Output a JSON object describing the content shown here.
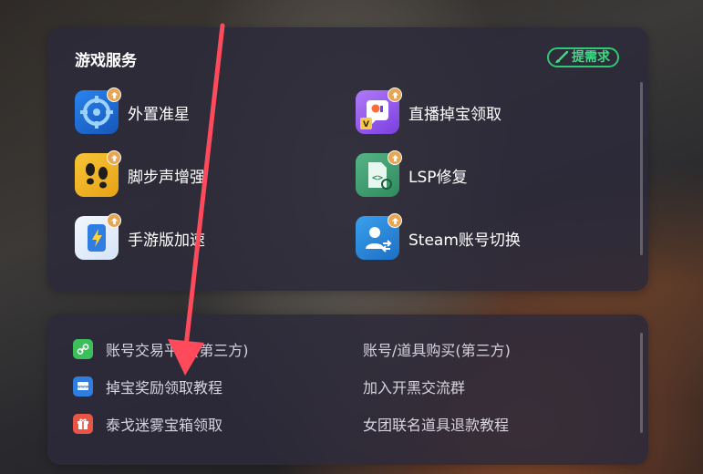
{
  "services_panel": {
    "title": "游戏服务",
    "request_button": "提需求",
    "items": [
      {
        "label": "外置准星",
        "icon": "crosshair-icon",
        "color": "#1f6fd6"
      },
      {
        "label": "直播掉宝领取",
        "icon": "twitch-drop-icon",
        "color": "#9b5cf0"
      },
      {
        "label": "脚步声增强",
        "icon": "footsteps-icon",
        "color": "#f2b21c"
      },
      {
        "label": "LSP修复",
        "icon": "lsp-fix-icon",
        "color": "#3f9e6e"
      },
      {
        "label": "手游版加速",
        "icon": "mobile-boost-icon",
        "color": "#e6eef9"
      },
      {
        "label": "Steam账号切换",
        "icon": "account-switch-icon",
        "color": "#2b8ee0"
      }
    ]
  },
  "links_panel": {
    "items": [
      {
        "label": "账号交易平台(第三方)",
        "icon": "link-icon",
        "color": "#3bbf5a"
      },
      {
        "label": "账号/道具购买(第三方)"
      },
      {
        "label": "掉宝奖励领取教程",
        "icon": "www-icon",
        "color": "#2f7de0"
      },
      {
        "label": "加入开黑交流群"
      },
      {
        "label": "泰戈迷雾宝箱领取",
        "icon": "gift-icon",
        "color": "#e85445"
      },
      {
        "label": "女团联名道具退款教程"
      }
    ]
  },
  "annotation": {
    "arrow_color": "#ff4a5c"
  }
}
